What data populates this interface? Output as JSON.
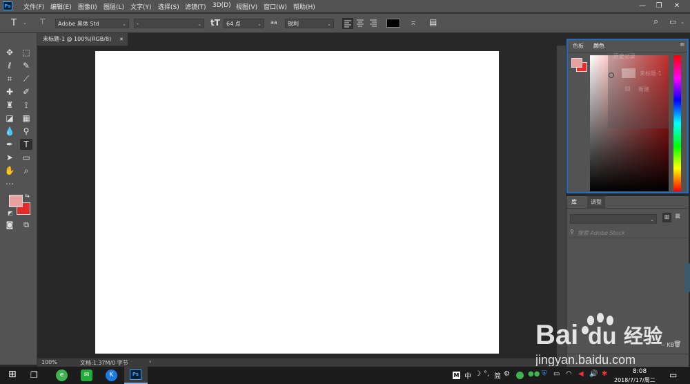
{
  "menubar": {
    "logo": "Ps",
    "items": [
      "文件(F)",
      "编辑(E)",
      "图像(I)",
      "图层(L)",
      "文字(Y)",
      "选择(S)",
      "滤镜(T)",
      "3D(D)",
      "视图(V)",
      "窗口(W)",
      "帮助(H)"
    ],
    "win_min": "—",
    "win_restore": "❐",
    "win_close": "✕"
  },
  "options": {
    "tool_glyph": "T",
    "font_family": "Adobe 黑体 Std",
    "font_style": "-",
    "font_size": "64 点",
    "aa_icon": "aa",
    "antialias": "锐利",
    "text_color": "#000000"
  },
  "document": {
    "tab_title": "未标题-1 @ 100%(RGB/8)",
    "tab_close": "✕",
    "zoom": "100%",
    "doc_info": "文档:1.37M/0 字节",
    "status_arrow": "›"
  },
  "color_panel": {
    "tab_swatches": "色板",
    "tab_color": "颜色",
    "foreground": "#e8a0a0",
    "background": "#e62b2b",
    "history_title": "历史记录",
    "history_item": "未标题-1",
    "history_new": "新建"
  },
  "library_panel": {
    "tab_library": "库",
    "tab_adjust": "调整",
    "search_placeholder": "搜索 Adobe Stock",
    "kb_label": "-- KB"
  },
  "taskbar": {
    "time": "8:08",
    "date": "2018/7/17/周二",
    "ime_m": "M",
    "ime_zh": "中",
    "ime_moon": "☽",
    "ime_deg": "°,",
    "ime_simp": "简"
  },
  "watermark": {
    "brand": "Bai",
    "brand2": "du",
    "brand_cn": "经验",
    "url": "jingyan.baidu.com"
  },
  "colors": {
    "accent": "#1f6fc5",
    "ps_blue": "#31a8ff"
  }
}
